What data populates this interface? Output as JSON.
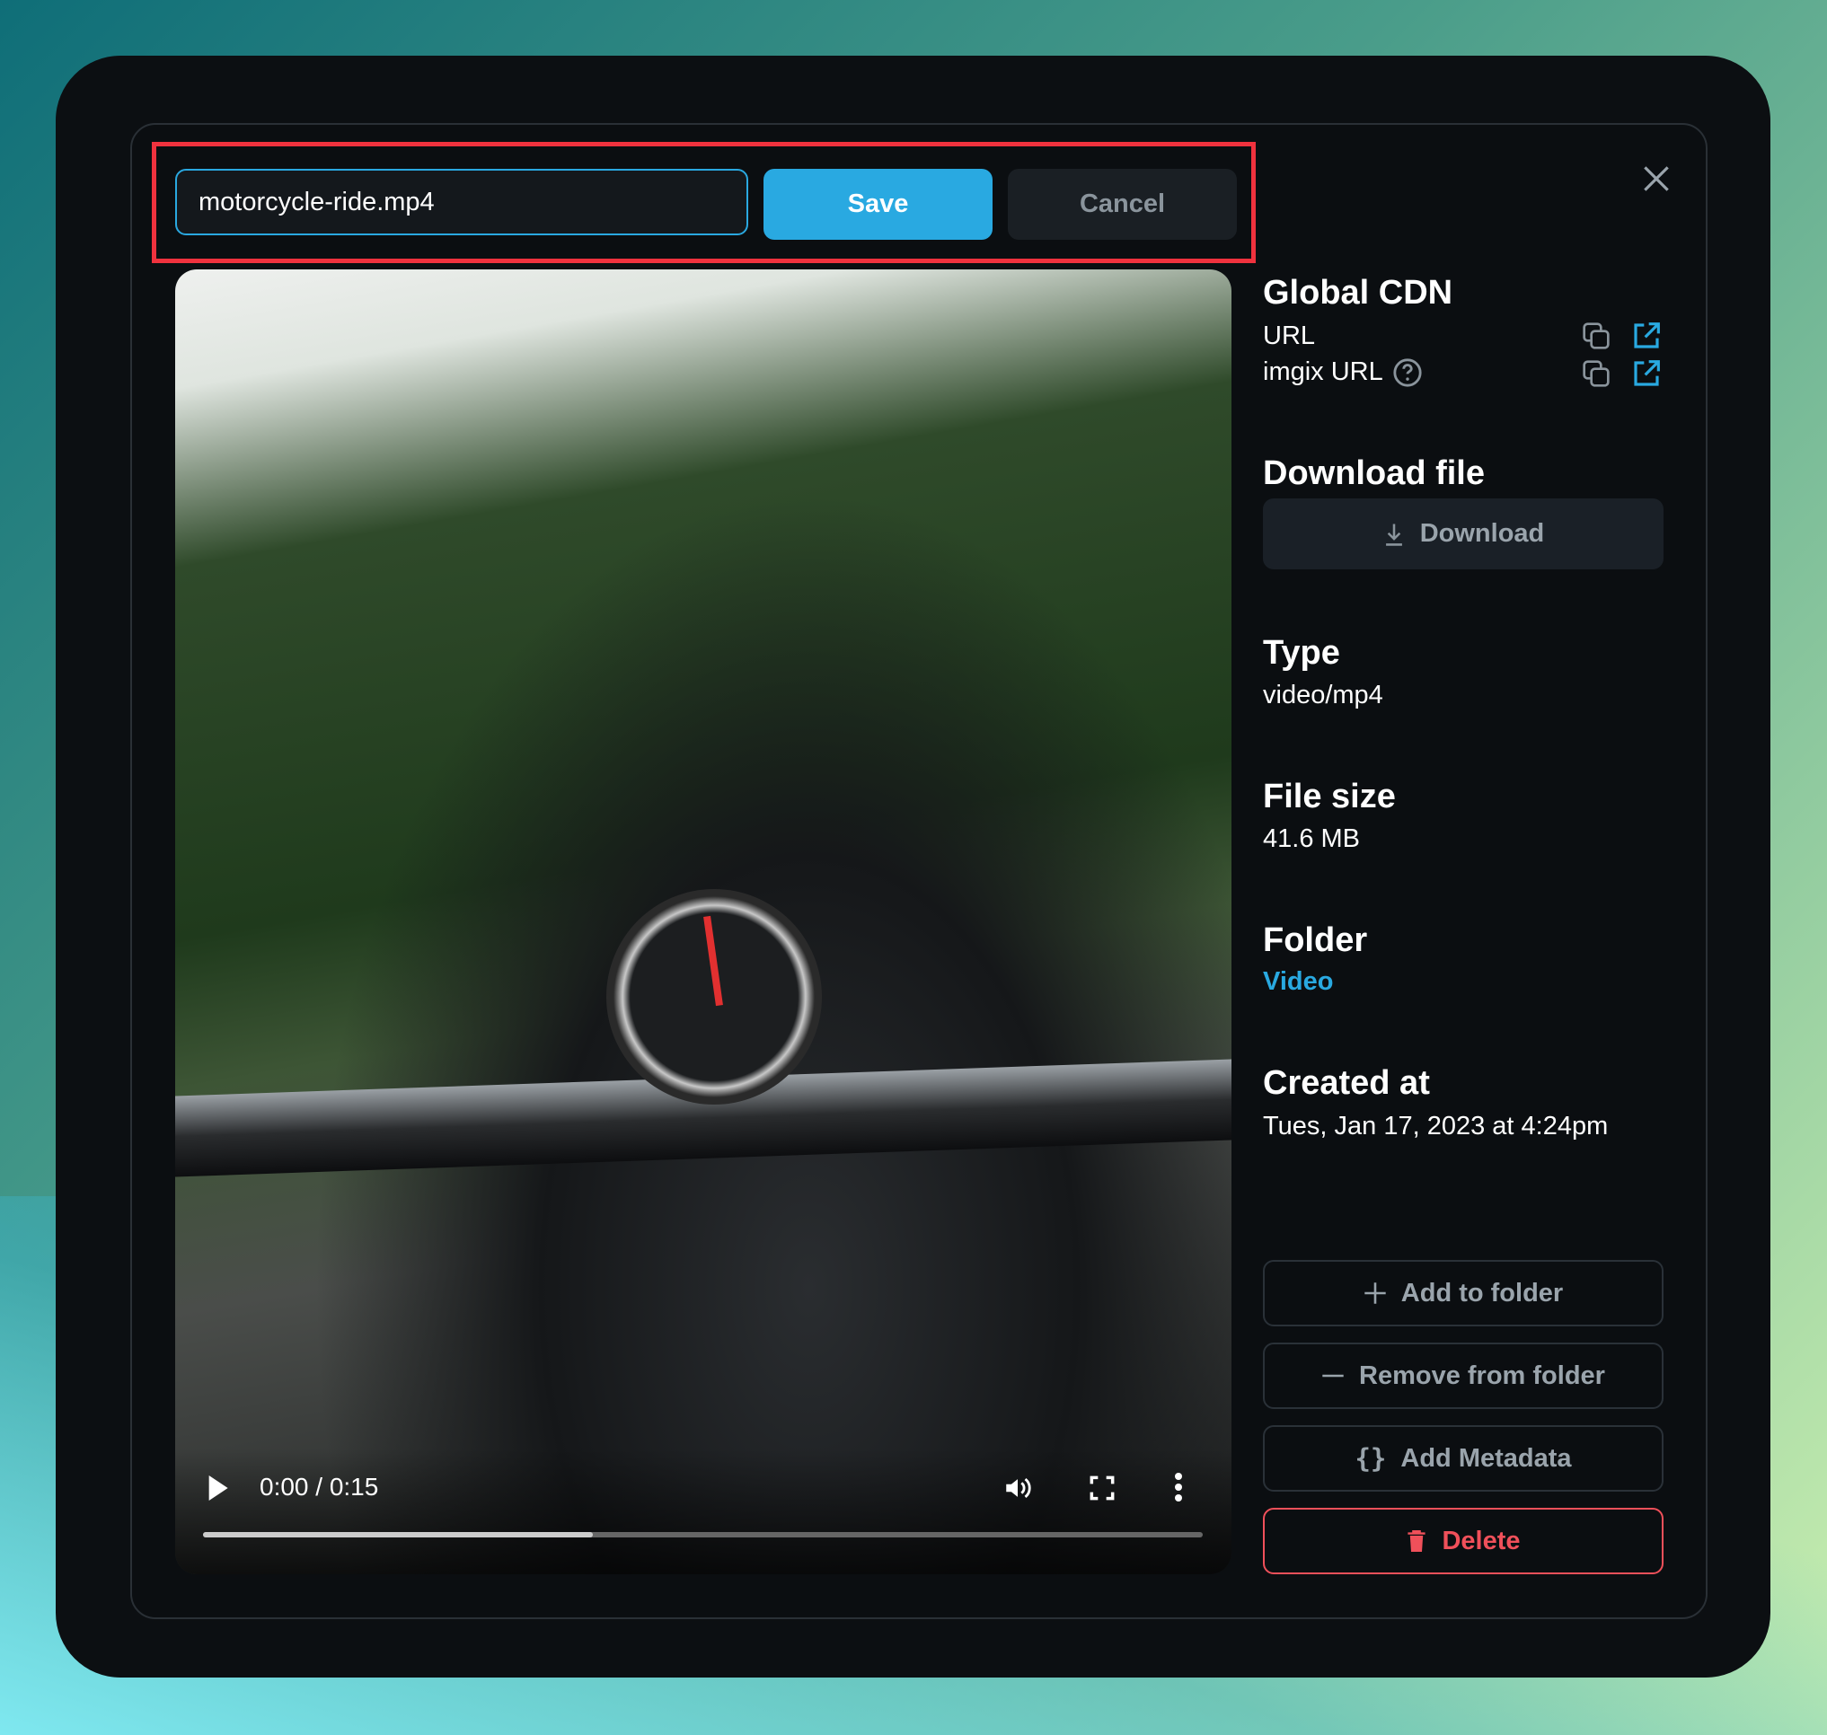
{
  "editor": {
    "filename": "motorcycle-ride.mp4",
    "save_label": "Save",
    "cancel_label": "Cancel"
  },
  "video": {
    "time": "0:00 / 0:15",
    "progress_percent": 39
  },
  "cdn": {
    "heading": "Global CDN",
    "url_label": "URL",
    "imgix_label": "imgix URL"
  },
  "download": {
    "heading": "Download file",
    "button_label": "Download"
  },
  "type": {
    "heading": "Type",
    "value": "video/mp4"
  },
  "file_size": {
    "heading": "File size",
    "value": "41.6 MB"
  },
  "folder": {
    "heading": "Folder",
    "value": "Video"
  },
  "created": {
    "heading": "Created at",
    "value": "Tues, Jan 17, 2023 at 4:24pm"
  },
  "actions": {
    "add_folder": "Add to folder",
    "remove_folder": "Remove from folder",
    "add_metadata": "Add Metadata",
    "delete": "Delete"
  },
  "colors": {
    "accent": "#29a9e1",
    "danger": "#f0505a",
    "highlight": "#f0323e"
  }
}
